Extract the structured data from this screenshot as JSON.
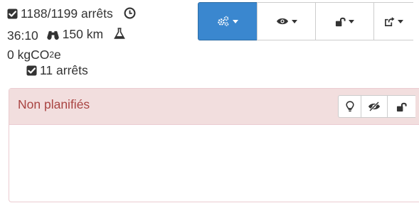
{
  "stats": {
    "stops_done": "1188/1199 arrêts",
    "duration": "36:10",
    "distance": "150 km",
    "co2_prefix": "0 kgCO",
    "co2_sub": "2",
    "co2_suffix": "e"
  },
  "toolbar": {
    "buttons": [
      {
        "icon": "gears-icon",
        "has_caret": true,
        "active": true
      },
      {
        "icon": "eye-icon",
        "has_caret": true
      },
      {
        "icon": "unlock-icon",
        "has_caret": true
      },
      {
        "icon": "share-icon",
        "has_caret": true
      }
    ]
  },
  "panel": {
    "title": "Non planifiés",
    "header_buttons": [
      "lightbulb-icon",
      "eye-slash-icon",
      "unlock-icon"
    ],
    "body_stops": "11 arrêts"
  },
  "colors": {
    "primary": "#3a87cf",
    "danger_bg": "#f2dede",
    "danger_border": "#ebccd1",
    "danger_text": "#a94442"
  }
}
